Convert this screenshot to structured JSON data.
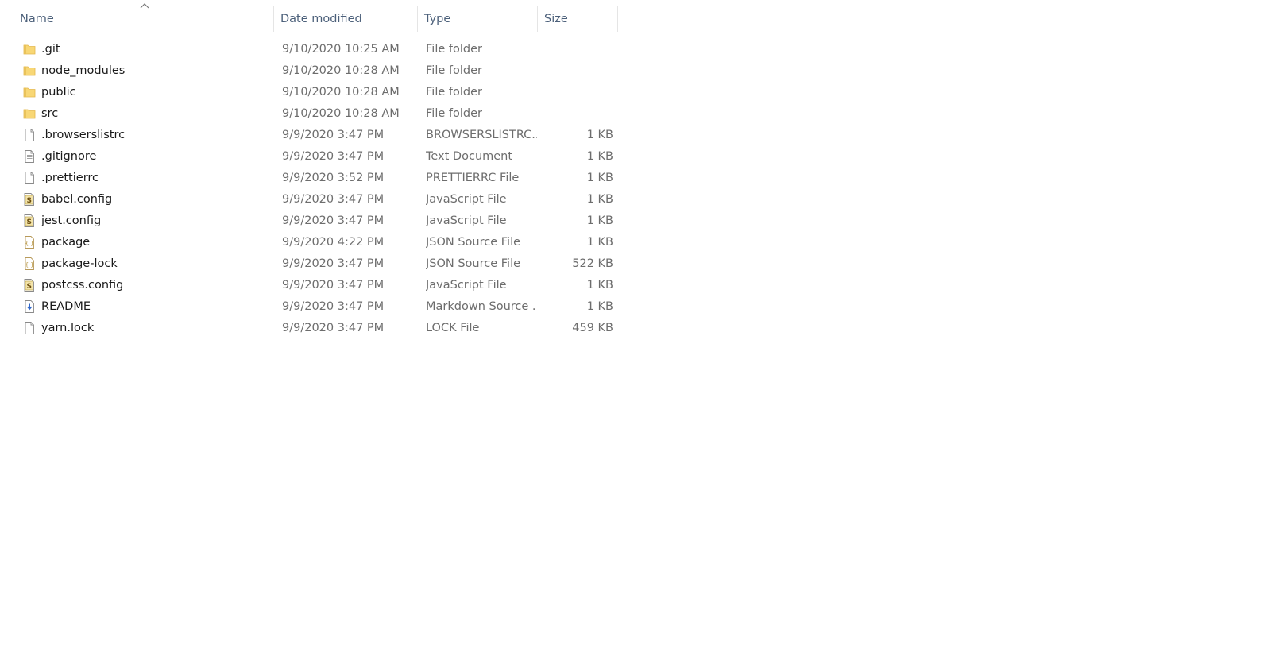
{
  "columns": {
    "name": "Name",
    "date": "Date modified",
    "type": "Type",
    "size": "Size"
  },
  "sort": {
    "column": "name",
    "direction": "ascending",
    "icon": "sort-up-icon"
  },
  "files": [
    {
      "name": ".git",
      "date": "9/10/2020 10:25 AM",
      "type": "File folder",
      "size": "",
      "icon": "folder-icon"
    },
    {
      "name": "node_modules",
      "date": "9/10/2020 10:28 AM",
      "type": "File folder",
      "size": "",
      "icon": "folder-icon"
    },
    {
      "name": "public",
      "date": "9/10/2020 10:28 AM",
      "type": "File folder",
      "size": "",
      "icon": "folder-icon"
    },
    {
      "name": "src",
      "date": "9/10/2020 10:28 AM",
      "type": "File folder",
      "size": "",
      "icon": "folder-icon"
    },
    {
      "name": ".browserslistrc",
      "date": "9/9/2020 3:47 PM",
      "type": "BROWSERSLISTRC...",
      "size": "1 KB",
      "icon": "blank-file-icon"
    },
    {
      "name": ".gitignore",
      "date": "9/9/2020 3:47 PM",
      "type": "Text Document",
      "size": "1 KB",
      "icon": "text-file-icon"
    },
    {
      "name": ".prettierrc",
      "date": "9/9/2020 3:52 PM",
      "type": "PRETTIERRC File",
      "size": "1 KB",
      "icon": "blank-file-icon"
    },
    {
      "name": "babel.config",
      "date": "9/9/2020 3:47 PM",
      "type": "JavaScript File",
      "size": "1 KB",
      "icon": "javascript-file-icon"
    },
    {
      "name": "jest.config",
      "date": "9/9/2020 3:47 PM",
      "type": "JavaScript File",
      "size": "1 KB",
      "icon": "javascript-file-icon"
    },
    {
      "name": "package",
      "date": "9/9/2020 4:22 PM",
      "type": "JSON Source File",
      "size": "1 KB",
      "icon": "json-file-icon"
    },
    {
      "name": "package-lock",
      "date": "9/9/2020 3:47 PM",
      "type": "JSON Source File",
      "size": "522 KB",
      "icon": "json-file-icon"
    },
    {
      "name": "postcss.config",
      "date": "9/9/2020 3:47 PM",
      "type": "JavaScript File",
      "size": "1 KB",
      "icon": "javascript-file-icon"
    },
    {
      "name": "README",
      "date": "9/9/2020 3:47 PM",
      "type": "Markdown Source ...",
      "size": "1 KB",
      "icon": "markdown-file-icon"
    },
    {
      "name": "yarn.lock",
      "date": "9/9/2020 3:47 PM",
      "type": "LOCK File",
      "size": "459 KB",
      "icon": "blank-file-icon"
    }
  ],
  "colors": {
    "header_text": "#4c607a",
    "secondary_text": "#6d6d6d",
    "folder": "#f8d775",
    "folder_dark": "#e4b84c"
  }
}
